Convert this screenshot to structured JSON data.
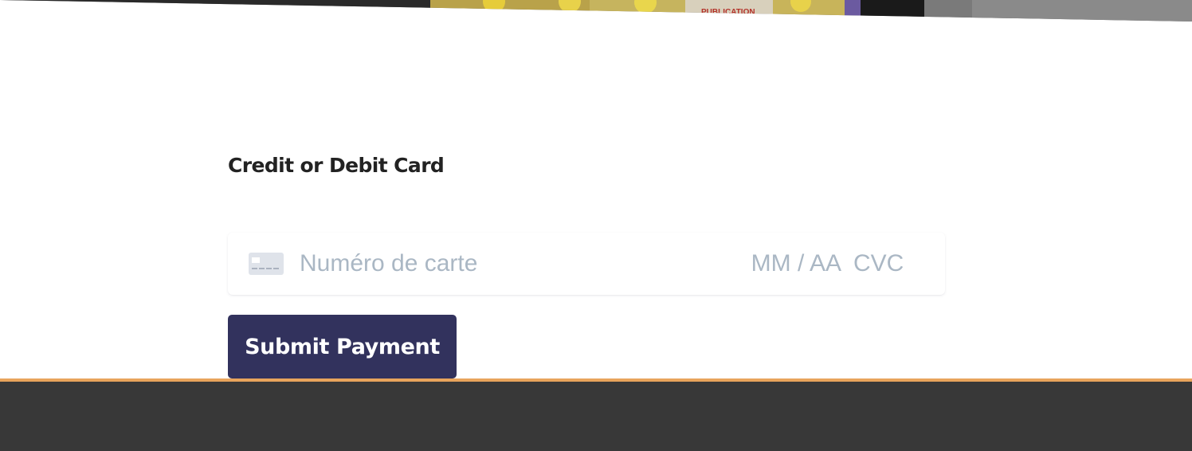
{
  "hero": {
    "image_label": "hero-photo-strip"
  },
  "form": {
    "title": "Credit or Debit Card",
    "card_number_placeholder": "Numéro de carte",
    "expiry_placeholder": "MM / AA",
    "cvc_placeholder": "CVC",
    "card_icon": "credit-card-icon",
    "submit_label": "Submit Payment"
  },
  "colors": {
    "button_bg": "#32325d",
    "placeholder": "#aab7c4",
    "footer_bg": "#383838",
    "footer_accent": "#e8a45c",
    "title": "#222222"
  }
}
